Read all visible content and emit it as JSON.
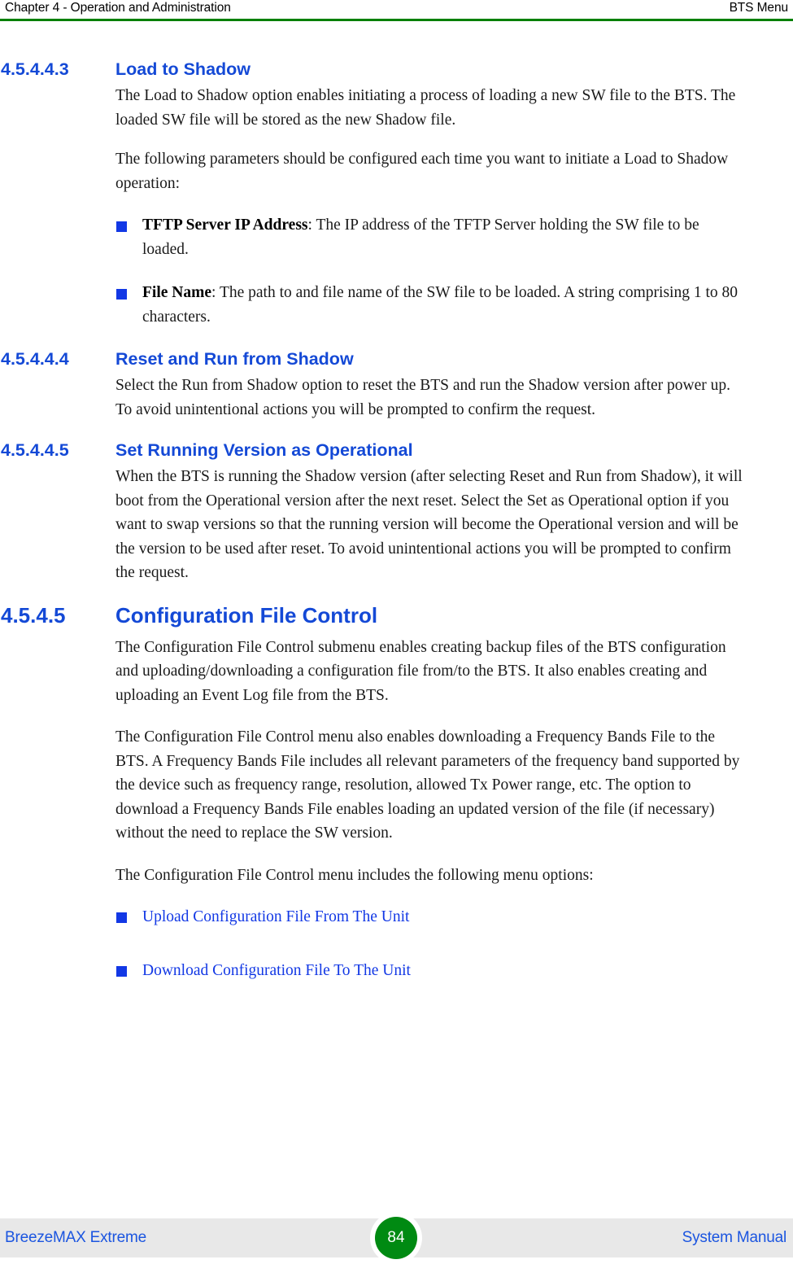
{
  "header": {
    "left": "Chapter 4 - Operation and Administration",
    "right": "BTS Menu",
    "rule_color": "#008000"
  },
  "sections": [
    {
      "number": "4.5.4.4.3",
      "title": "Load to Shadow",
      "level": 4,
      "paragraphs": [
        "The Load to Shadow option enables initiating a process of loading a new SW file to the BTS. The loaded SW file will be stored as the new Shadow file.",
        "The following parameters should be configured each time you want to initiate a Load to Shadow operation:"
      ],
      "bullets": [
        {
          "lead": "TFTP Server IP Address",
          "rest": ": The IP address of the TFTP Server holding the SW file to be loaded."
        },
        {
          "lead": "File Name",
          "rest": ": The path to and file name of the SW file to be loaded. A string comprising 1 to 80 characters."
        }
      ]
    },
    {
      "number": "4.5.4.4.4",
      "title": "Reset and Run from Shadow",
      "level": 4,
      "paragraphs": [
        "Select the Run from Shadow option to reset the BTS and run the Shadow version after power up. To avoid unintentional actions you will be prompted to confirm the request."
      ]
    },
    {
      "number": "4.5.4.4.5",
      "title": "Set Running Version as Operational",
      "level": 4,
      "paragraphs": [
        "When the BTS is running the Shadow version (after selecting Reset and Run from Shadow), it will boot from the Operational version after the next reset. Select the Set as Operational option if you want to swap versions so that the running version will become the Operational version and will be the version to be used after reset. To avoid unintentional actions you will be prompted to confirm the request."
      ]
    },
    {
      "number": "4.5.4.5",
      "title": "Configuration File Control",
      "level": 3,
      "paragraphs": [
        "The Configuration File Control submenu enables creating backup files of the BTS configuration and uploading/downloading a configuration file from/to the BTS. It also enables creating and uploading an Event Log file from the BTS.",
        "The Configuration File Control menu also enables downloading a Frequency Bands File to the BTS. A Frequency Bands File includes all relevant parameters of the frequency band supported by the device such as frequency range, resolution, allowed Tx Power range, etc. The option to download a Frequency Bands File enables loading an updated version of the file (if necessary) without the need to replace the SW version.",
        "The Configuration File Control menu includes the following menu options:"
      ],
      "links": [
        "Upload Configuration File From The Unit",
        "Download Configuration File To The Unit"
      ]
    }
  ],
  "footer": {
    "left": "BreezeMAX Extreme",
    "right": "System Manual",
    "page_number": "84",
    "badge_color": "#008a12",
    "band_color": "#e8e8e8",
    "text_color": "#1b55e0"
  },
  "colors": {
    "heading_blue": "#1449d6",
    "link_blue": "#1238e5",
    "rule_green": "#008000"
  }
}
